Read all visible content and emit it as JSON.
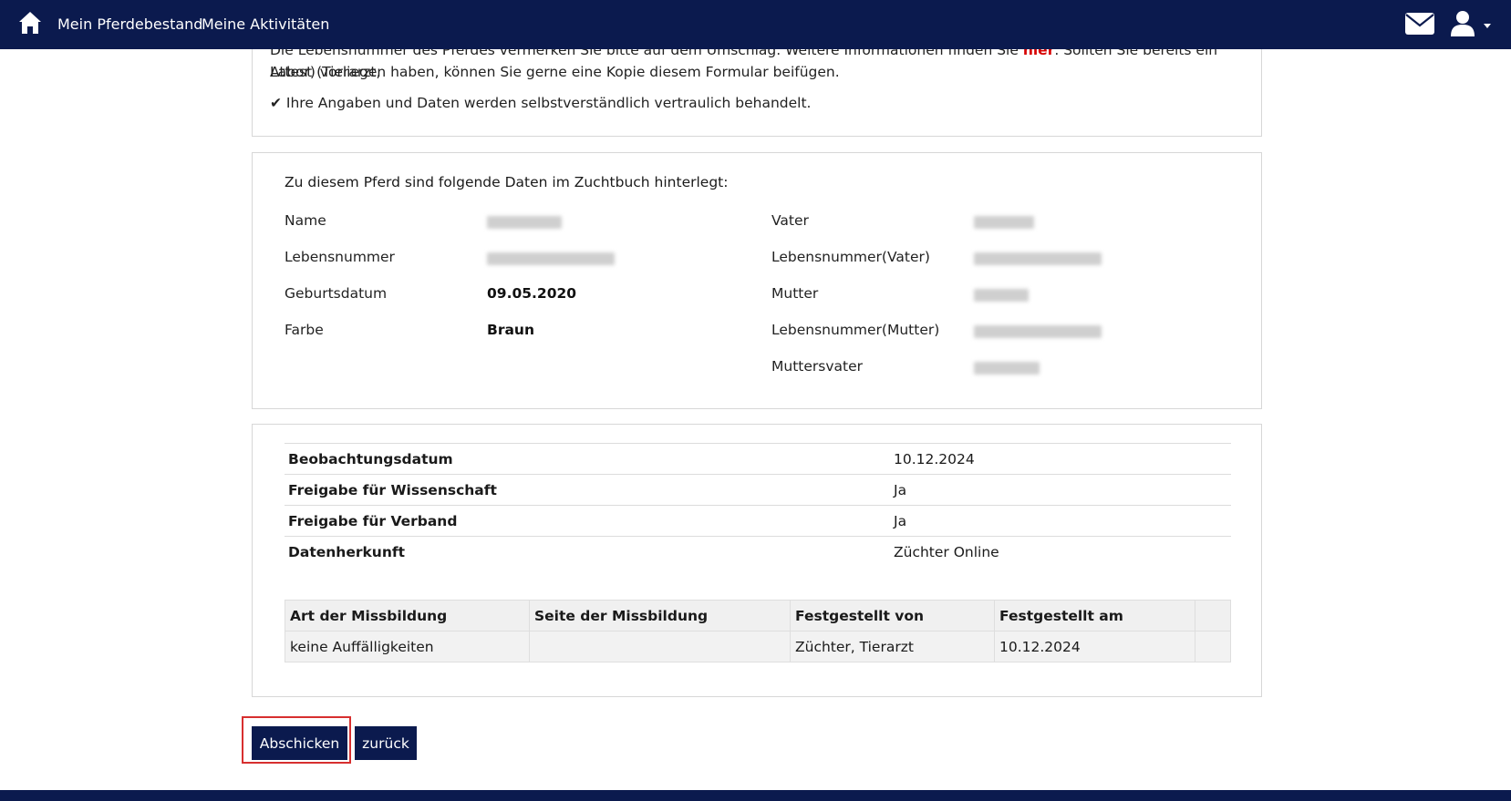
{
  "nav": {
    "home_label": "home-icon",
    "items": [
      "Mein Pferdebestand",
      "Meine Aktivitäten"
    ],
    "mail_icon": "mail-icon",
    "user_icon": "user-icon"
  },
  "info": {
    "line1_prefix": "Die Lebensnummer des Pferdes vermerken Sie bitte auf dem Umschlag. Weitere Informationen finden Sie ",
    "line1_link": "hier",
    "line1_suffix": ". Sollten Sie bereits ein Attest (Tierarzt,",
    "line2": "Labor) vorliegen haben, können Sie gerne eine Kopie diesem Formular beifügen.",
    "line3": "✔ Ihre Angaben und Daten werden selbstverständlich vertraulich behandelt."
  },
  "horse": {
    "intro": "Zu diesem Pferd sind folgende Daten im Zuchtbuch hinterlegt:",
    "left": [
      {
        "label": "Name",
        "value": ""
      },
      {
        "label": "Lebensnummer",
        "value": ""
      },
      {
        "label": "Geburtsdatum",
        "value": "09.05.2020"
      },
      {
        "label": "Farbe",
        "value": "Braun"
      }
    ],
    "right": [
      {
        "label": "Vater",
        "value": ""
      },
      {
        "label": "Lebensnummer(Vater)",
        "value": ""
      },
      {
        "label": "Mutter",
        "value": ""
      },
      {
        "label": "Lebensnummer(Mutter)",
        "value": ""
      },
      {
        "label": "Muttersvater",
        "value": ""
      }
    ]
  },
  "observation": {
    "rows": [
      {
        "key": "Beobachtungsdatum",
        "value": "10.12.2024"
      },
      {
        "key": "Freigabe für Wissenschaft",
        "value": "Ja"
      },
      {
        "key": "Freigabe für Verband",
        "value": "Ja"
      },
      {
        "key": "Datenherkunft",
        "value": "Züchter Online"
      }
    ],
    "table": {
      "headers": [
        "Art der Missbildung",
        "Seite der Missbildung",
        "Festgestellt von",
        "Festgestellt am",
        ""
      ],
      "rows": [
        [
          "keine Auffälligkeiten",
          "",
          "Züchter, Tierarzt",
          "10.12.2024",
          ""
        ]
      ]
    }
  },
  "buttons": {
    "submit": "Abschicken",
    "back": "zurück"
  },
  "colors": {
    "navbar": "#0b1a4e",
    "button": "#0b1a4e",
    "link_red": "#d60000",
    "focus_ring": "#d72f2f"
  }
}
